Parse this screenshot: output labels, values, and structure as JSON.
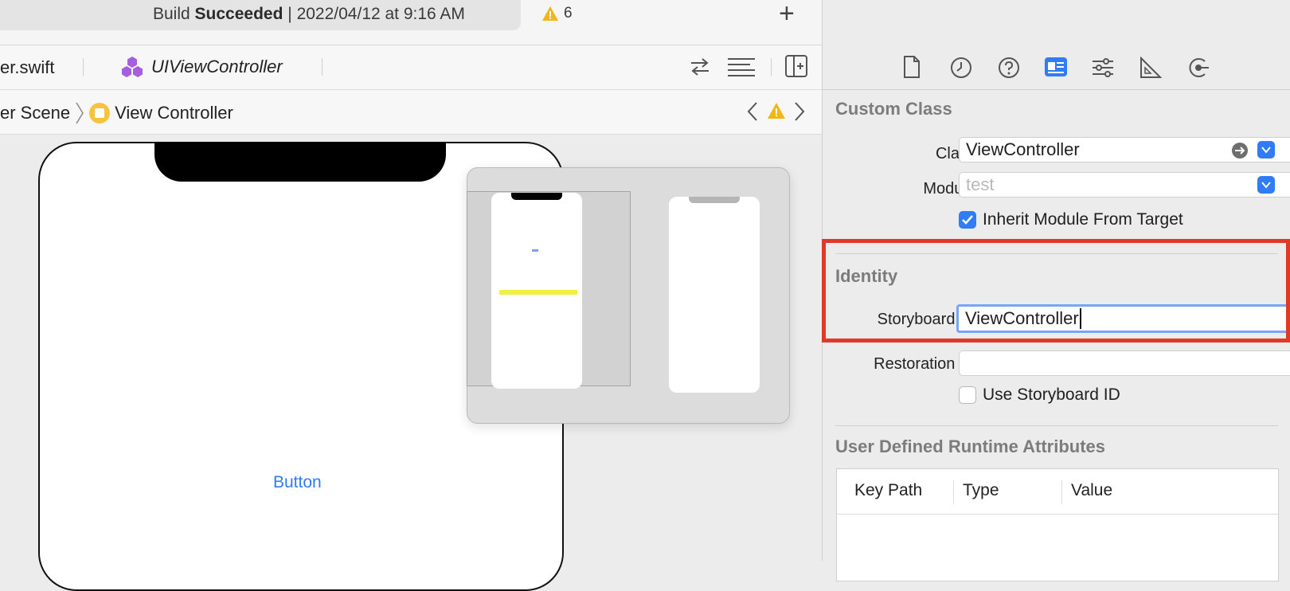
{
  "toolbar": {
    "status_prefix": "Build",
    "status_bold": "Succeeded",
    "status_suffix": "| 2022/04/12 at 9:16 AM",
    "warning_count": "6",
    "add_label": "+"
  },
  "tabs": [
    {
      "label": "er.swift"
    },
    {
      "label": "UIViewController"
    }
  ],
  "jumpbar": {
    "scene": "er Scene",
    "controller": "View Controller"
  },
  "canvas": {
    "button_label": "Button"
  },
  "inspector": {
    "custom_class": {
      "title": "Custom Class",
      "class_label": "Class",
      "class_value": "ViewController",
      "module_label": "Module",
      "module_placeholder": "test",
      "inherit_label": "Inherit Module From Target",
      "inherit_checked": true
    },
    "identity": {
      "title": "Identity",
      "storyboard_id_label": "Storyboard ID",
      "storyboard_id_value": "ViewController",
      "restoration_id_label": "Restoration ID",
      "restoration_id_value": "",
      "use_storyboard_id_label": "Use Storyboard ID",
      "use_storyboard_id_checked": false
    },
    "runtime_attributes": {
      "title": "User Defined Runtime Attributes",
      "columns": [
        "Key Path",
        "Type",
        "Value"
      ]
    }
  },
  "colors": {
    "accent": "#2f7cf6",
    "highlight": "#e0392a",
    "warning": "#f2b619"
  }
}
